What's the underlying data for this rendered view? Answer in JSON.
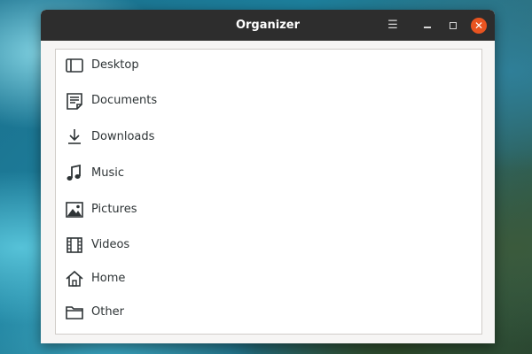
{
  "window": {
    "title": "Organizer",
    "controls": {
      "menu_icon": "hamburger-menu-icon",
      "minimize_icon": "minimize-icon",
      "maximize_icon": "maximize-icon",
      "close_icon": "close-icon",
      "close_color": "#e95420"
    }
  },
  "places": [
    {
      "label": "Desktop",
      "icon": "desktop-icon"
    },
    {
      "label": "Documents",
      "icon": "document-icon"
    },
    {
      "label": "Downloads",
      "icon": "download-icon"
    },
    {
      "label": "Music",
      "icon": "music-icon"
    },
    {
      "label": "Pictures",
      "icon": "picture-icon"
    },
    {
      "label": "Videos",
      "icon": "video-icon"
    },
    {
      "label": "Home",
      "icon": "home-icon"
    },
    {
      "label": "Other",
      "icon": "folder-icon"
    }
  ]
}
